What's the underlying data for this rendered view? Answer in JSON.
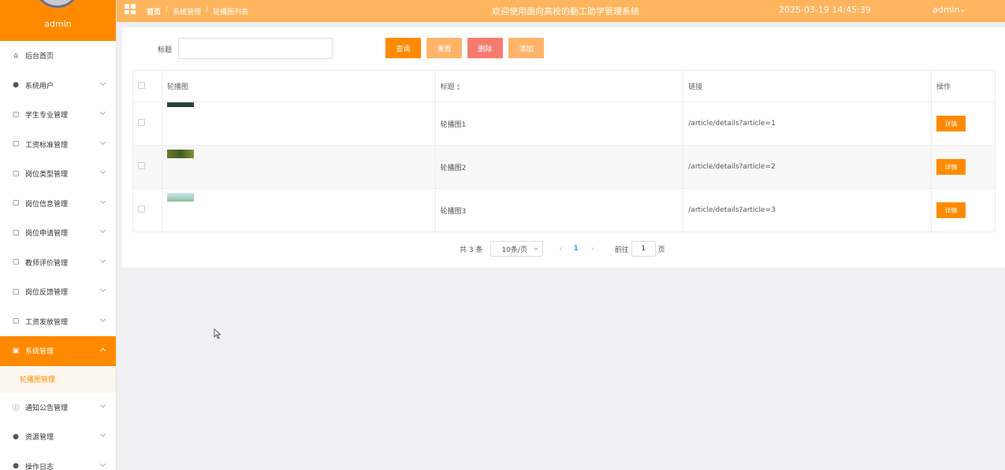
{
  "sidebar": {
    "username": "admin",
    "items": [
      {
        "label": "后台首页",
        "icon": "home-icon",
        "glyph": "⌂",
        "chev": false
      },
      {
        "label": "系统用户",
        "icon": "user-icon",
        "glyph": "●",
        "chev": true
      },
      {
        "label": "学生专业管理",
        "icon": "folder-icon",
        "glyph": "▢",
        "chev": true
      },
      {
        "label": "工资标准管理",
        "icon": "folder-icon",
        "glyph": "▢",
        "chev": true
      },
      {
        "label": "岗位类型管理",
        "icon": "folder-icon",
        "glyph": "▢",
        "chev": true
      },
      {
        "label": "岗位信息管理",
        "icon": "folder-icon",
        "glyph": "▢",
        "chev": true
      },
      {
        "label": "岗位申请管理",
        "icon": "folder-icon",
        "glyph": "▢",
        "chev": true
      },
      {
        "label": "教师评价管理",
        "icon": "folder-icon",
        "glyph": "▢",
        "chev": true
      },
      {
        "label": "岗位反馈管理",
        "icon": "folder-icon",
        "glyph": "▢",
        "chev": true
      },
      {
        "label": "工资发放管理",
        "icon": "folder-icon",
        "glyph": "▢",
        "chev": true
      },
      {
        "label": "系统管理",
        "icon": "image-icon",
        "glyph": "▣",
        "chev": true,
        "active": true
      },
      {
        "label": "通知公告管理",
        "icon": "info-icon",
        "glyph": "ⓘ",
        "chev": true
      },
      {
        "label": "资源管理",
        "icon": "location-icon",
        "glyph": "●",
        "chev": true
      },
      {
        "label": "操作日志",
        "icon": "user-icon",
        "glyph": "●",
        "chev": true
      }
    ],
    "sub_item": "轮播图管理"
  },
  "topbar": {
    "breadcrumb": [
      "首页",
      "系统管理",
      "轮播图列表"
    ],
    "separator": "/",
    "title": "欢迎使用面向高校的勤工助学管理系统",
    "datetime": "2025-03-19 14:45:39",
    "user": "admin",
    "user_caret": "▾"
  },
  "search": {
    "label": "标题",
    "value": "",
    "placeholder": ""
  },
  "buttons": {
    "query": "查询",
    "reset": "重置",
    "delete": "删除",
    "add": "添加"
  },
  "table": {
    "headers": {
      "image": "轮播图",
      "title": "标题",
      "link": "链接",
      "action": "操作"
    },
    "rows": [
      {
        "title": "轮播图1",
        "link": "/article/details?article=1",
        "action": "详情"
      },
      {
        "title": "轮播图2",
        "link": "/article/details?article=2",
        "action": "详情"
      },
      {
        "title": "轮播图3",
        "link": "/article/details?article=3",
        "action": "详情"
      }
    ]
  },
  "pagination": {
    "total": "共 3 条",
    "page_size": "10条/页",
    "current_page": "1",
    "goto_label": "前往",
    "goto_value": "1",
    "page_unit": "页",
    "prev": "‹",
    "next": "›"
  },
  "colors": {
    "accent": "#ff8a00",
    "topbar": "#ffb55e",
    "danger": "#f67b6f",
    "light_accent": "#ffb46a"
  }
}
